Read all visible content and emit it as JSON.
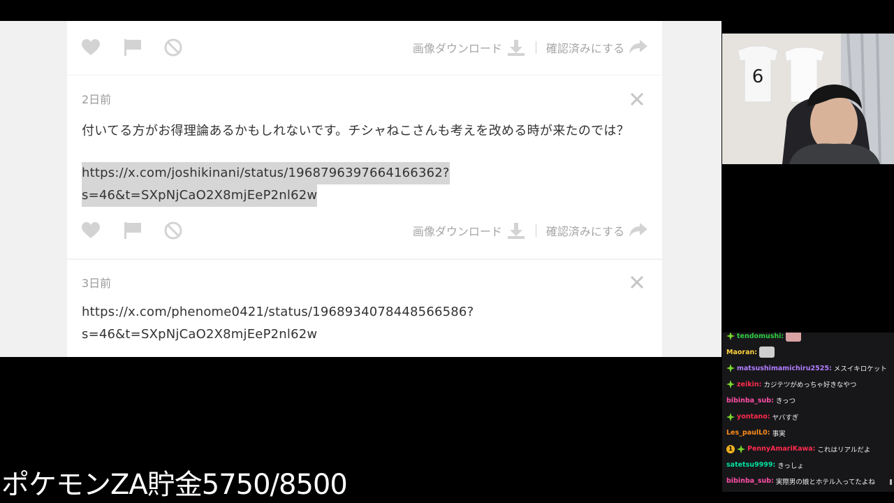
{
  "feed": {
    "top_card": {
      "download_label": "画像ダウンロード",
      "confirm_label": "確認済みにする"
    },
    "cards": [
      {
        "age": "2日前",
        "message": "付いてる方がお得理論あるかもしれないです。チシャねこさんも考えを改める時が来たのでは？",
        "link_lines": [
          "https://x.com/joshikinani/status/1968796397664166362?",
          "s=46&t=SXpNjCaO2X8mjEeP2nl62w"
        ],
        "download_label": "画像ダウンロード",
        "confirm_label": "確認済みにする"
      },
      {
        "age": "3日前",
        "link_lines": [
          "https://x.com/phenome0421/status/1968934078448566586?",
          "s=46&t=SXpNjCaO2X8mjEeP2nl62w"
        ]
      }
    ]
  },
  "chat": {
    "messages": [
      {
        "user": "tendomushi",
        "user_color": "#2ecc40",
        "text": "",
        "badges": [
          "leaf"
        ],
        "emote": "pink"
      },
      {
        "user": "Maoran",
        "user_color": "#ffd23c",
        "text": "",
        "badges": [],
        "emote": "cat"
      },
      {
        "user": "matsushimamichiru2525",
        "user_color": "#b27dff",
        "text": "メスイキロケット",
        "badges": [
          "leaf"
        ]
      },
      {
        "user": "zeikin",
        "user_color": "#ff2a4d",
        "text": "カジテツがめっちゃ好きなやつ",
        "badges": [
          "leaf"
        ]
      },
      {
        "user": "bibinba_sub",
        "user_color": "#ff4fa3",
        "text": "きっつ",
        "badges": []
      },
      {
        "user": "yontano",
        "user_color": "#ff2a4d",
        "text": "ヤバすぎ",
        "badges": [
          "leaf"
        ]
      },
      {
        "user": "Les_paulL0",
        "user_color": "#ff8c1a",
        "text": "事実",
        "badges": []
      },
      {
        "user": "PennyAmariKawa",
        "user_color": "#ff2a4d",
        "text": "これはリアルだよ",
        "badges": [
          "coin",
          "leaf"
        ]
      },
      {
        "user": "satetsu9999",
        "user_color": "#00e0a0",
        "text": "きっしょ",
        "badges": []
      },
      {
        "user": "bibinba_sub",
        "user_color": "#ff4fa3",
        "text": "実際男の娘とホテル入ってたよね",
        "badges": []
      }
    ]
  },
  "overlay": {
    "goal_text": "ポケモンZA貯金5750/8500"
  },
  "colors": {
    "icon_gray": "#d0d0d0",
    "chat_bg": "#17171a",
    "badge_green": "#7bd82e"
  }
}
